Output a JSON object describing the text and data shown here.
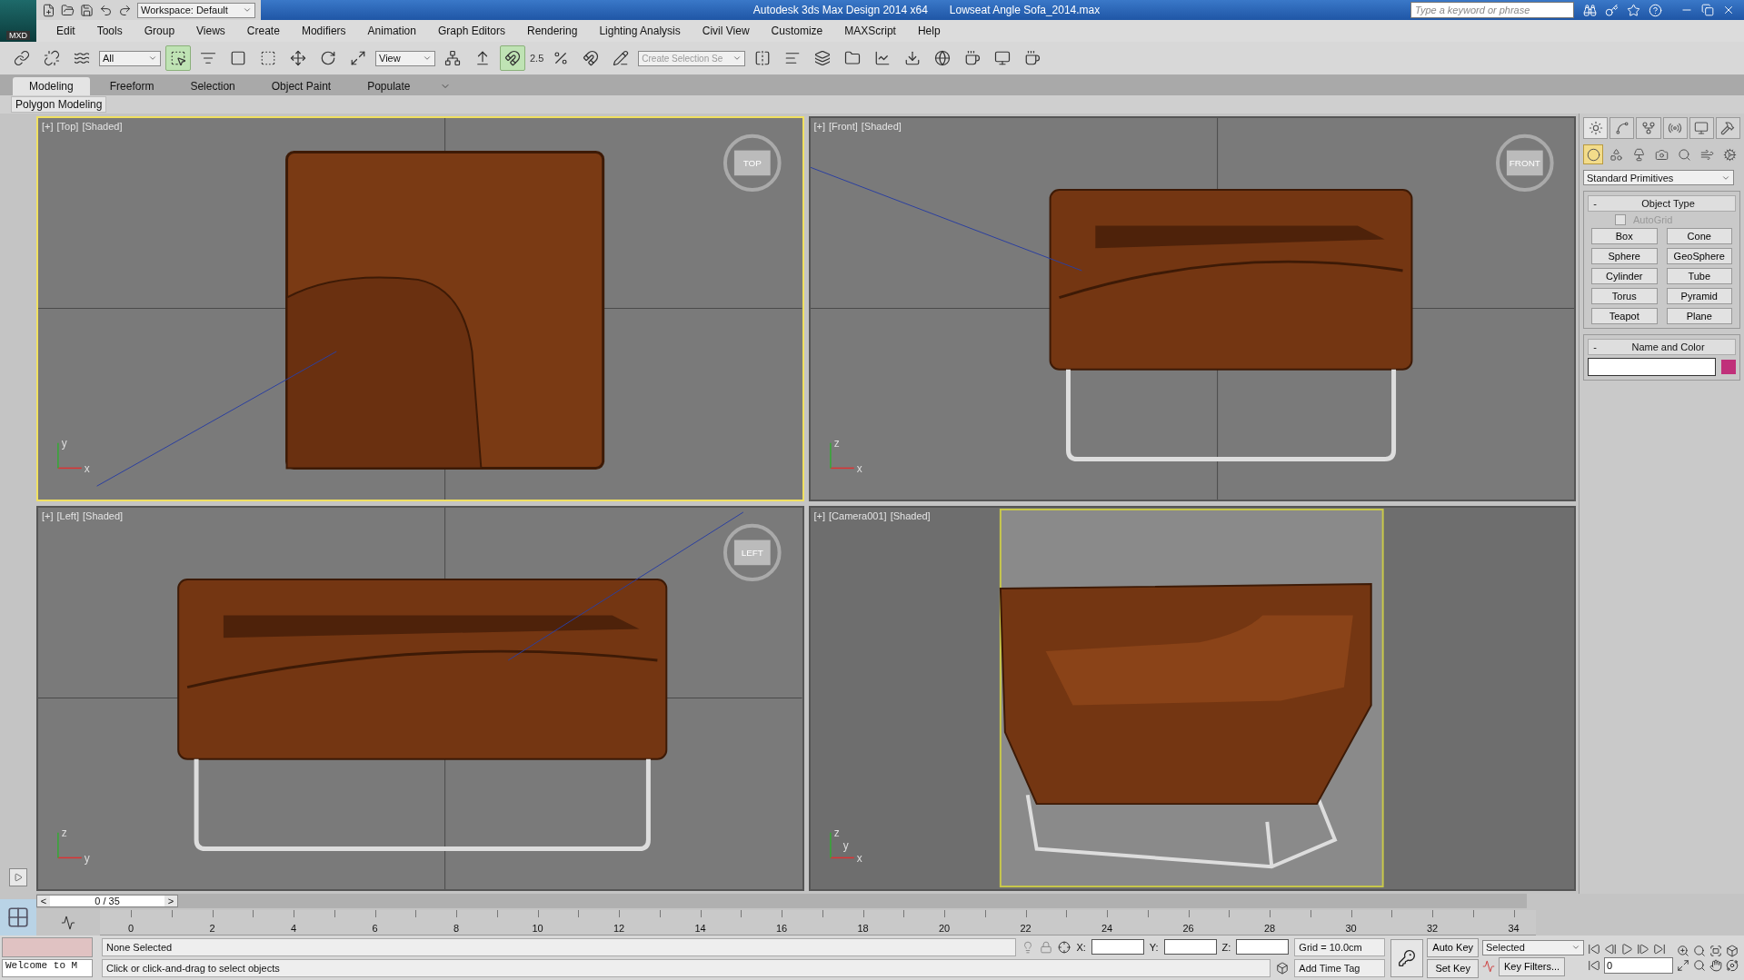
{
  "title_bar": {
    "app_label": "MXD",
    "workspace": "Workspace: Default",
    "title": "Autodesk 3ds Max Design 2014 x64",
    "file": "Lowseat Angle Sofa_2014.max",
    "search_placeholder": "Type a keyword or phrase"
  },
  "menu": [
    "Edit",
    "Tools",
    "Group",
    "Views",
    "Create",
    "Modifiers",
    "Animation",
    "Graph Editors",
    "Rendering",
    "Lighting Analysis",
    "Civil View",
    "Customize",
    "MAXScript",
    "Help"
  ],
  "toolbar": {
    "selection_filter": "All",
    "ref_coord": "View",
    "snap_label": "2.5",
    "named_selection_placeholder": "Create Selection Se",
    "tools": [
      {
        "selected": false
      },
      {
        "selected": false
      },
      {
        "selected": false
      },
      {
        "selected": true
      },
      {
        "selected": false
      },
      {
        "selected": false
      },
      {
        "selected": false
      },
      {
        "selected": false
      },
      {
        "selected": false
      },
      {
        "selected": false
      },
      {
        "selected": false
      },
      {
        "selected": false
      },
      {
        "selected": true
      }
    ]
  },
  "ribbon": {
    "tabs": [
      {
        "label": "Modeling",
        "selected": true
      },
      {
        "label": "Freeform",
        "selected": false
      },
      {
        "label": "Selection",
        "selected": false
      },
      {
        "label": "Object Paint",
        "selected": false
      },
      {
        "label": "Populate",
        "selected": false
      }
    ],
    "panel": "Polygon Modeling"
  },
  "viewports": [
    {
      "kind": "top",
      "labels": [
        "[+]",
        "[Top]",
        "[Shaded]"
      ],
      "active": true,
      "viewcube": "TOP",
      "axes": [
        "y",
        "x"
      ]
    },
    {
      "kind": "front",
      "labels": [
        "[+]",
        "[Front]",
        "[Shaded]"
      ],
      "active": false,
      "viewcube": "FRONT",
      "axes": [
        "z",
        "x"
      ]
    },
    {
      "kind": "left",
      "labels": [
        "[+]",
        "[Left]",
        "[Shaded]"
      ],
      "active": false,
      "viewcube": "LEFT",
      "axes": [
        "z",
        "y"
      ]
    },
    {
      "kind": "camera",
      "labels": [
        "[+]",
        "[Camera001]",
        "[Shaded]"
      ],
      "active": false,
      "axes": [
        "z",
        "x",
        "y"
      ]
    }
  ],
  "command_panel": {
    "tabs": [
      {
        "selected": true
      },
      {
        "selected": false
      },
      {
        "selected": false
      },
      {
        "selected": false
      },
      {
        "selected": false
      },
      {
        "selected": false
      }
    ],
    "categories": [
      {
        "selected": true
      },
      {
        "selected": false
      },
      {
        "selected": false
      },
      {
        "selected": false
      },
      {
        "selected": false
      },
      {
        "selected": false
      },
      {
        "selected": false
      }
    ],
    "dropdown": "Standard Primitives",
    "object_type": {
      "collapse": "-",
      "title": "Object Type",
      "autogrid": {
        "label": "AutoGrid",
        "checked": false,
        "disabled": true
      },
      "buttons": [
        "Box",
        "Cone",
        "Sphere",
        "GeoSphere",
        "Cylinder",
        "Tube",
        "Torus",
        "Pyramid",
        "Teapot",
        "Plane"
      ]
    },
    "name_color": {
      "collapse": "-",
      "title": "Name and Color",
      "color": "#c0307a"
    }
  },
  "timeline": {
    "frame": "0 / 35",
    "prev": "<",
    "next": ">",
    "level": 0,
    "ticks": [
      "0",
      "2",
      "4",
      "6",
      "8",
      "10",
      "12",
      "14",
      "16",
      "18",
      "20",
      "22",
      "24",
      "26",
      "28",
      "30",
      "32",
      "34"
    ]
  },
  "status": {
    "listener": "Welcome to M",
    "selection": "None Selected",
    "prompt": "Click or click-and-drag to select objects",
    "x_label": "X:",
    "y_label": "Y:",
    "z_label": "Z:",
    "grid": "Grid = 10.0cm",
    "add_time_tag": "Add Time Tag",
    "auto_key": "Auto Key",
    "set_key": "Set Key",
    "key_mode": "Selected",
    "key_filters": "Key Filters...",
    "current_frame": "0"
  }
}
